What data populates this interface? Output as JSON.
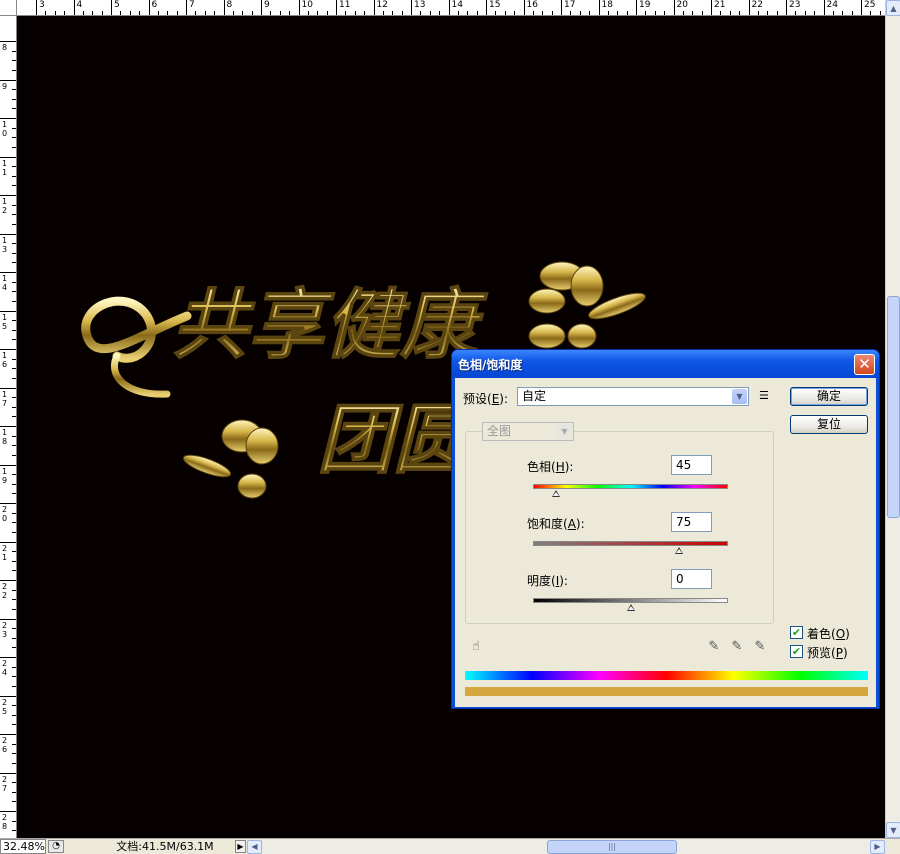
{
  "ruler": {
    "top_labels": [
      "3",
      "4",
      "5",
      "6",
      "7",
      "8",
      "9",
      "10",
      "11",
      "12",
      "13",
      "14",
      "15",
      "16",
      "17",
      "18",
      "19",
      "20",
      "21",
      "22",
      "23",
      "24",
      "25"
    ],
    "left_labels": [
      "8",
      "9",
      "10",
      "11",
      "12",
      "13",
      "14",
      "15",
      "16",
      "17",
      "18",
      "19",
      "20",
      "21",
      "22",
      "23",
      "24",
      "25",
      "26",
      "27",
      "28"
    ]
  },
  "canvas": {
    "artwork_line1": "共享健康",
    "artwork_line2": "团圆",
    "background": "#070000",
    "text_color": "#d4b54a"
  },
  "status_bar": {
    "zoom": "32.48%",
    "doc_info": "文档:41.5M/63.1M"
  },
  "dialog": {
    "title": "色相/饱和度",
    "close_glyph": "✕",
    "preset_label_pre": "预设(",
    "preset_key": "E",
    "preset_label_post": "):",
    "preset_value": "自定",
    "ok_label": "确定",
    "reset_label": "复位",
    "channel_value": "全图",
    "hue": {
      "label_pre": "色相(",
      "key": "H",
      "label_post": "):",
      "value": "45",
      "level_fraction": 0.12
    },
    "saturation": {
      "label_pre": "饱和度(",
      "key": "A",
      "label_post": "):",
      "value": "75",
      "level_fraction": 0.75
    },
    "lightness": {
      "label_pre": "明度(",
      "key": "I",
      "label_post": "):",
      "value": "0",
      "level_fraction": 0.5
    },
    "colorize": {
      "label_pre": "着色(",
      "key": "O",
      "label_post": ")",
      "checked": true
    },
    "preview": {
      "label_pre": "预览(",
      "key": "P",
      "label_post": ")",
      "checked": true
    },
    "result_color": "#d4a83e"
  }
}
